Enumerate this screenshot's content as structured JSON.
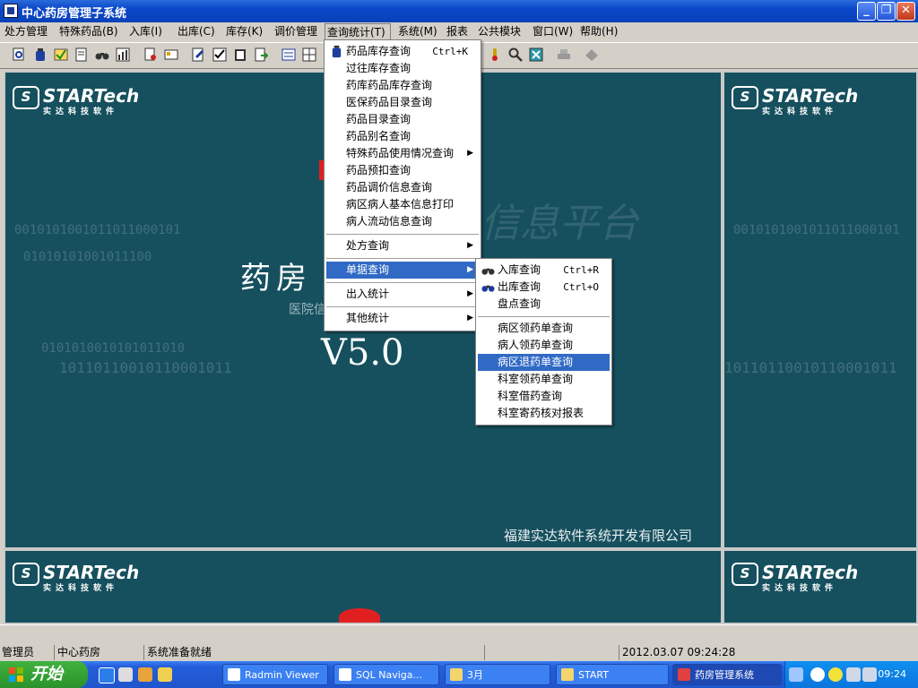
{
  "window": {
    "title": "中心药房管理子系统",
    "buttons": {
      "minimize": "_",
      "restore": "❐",
      "close": "✕"
    }
  },
  "menubar": [
    {
      "label": "处方管理"
    },
    {
      "label": "特殊药品(B)"
    },
    {
      "label": "入库(I)"
    },
    {
      "label": "出库(C)"
    },
    {
      "label": "库存(K)"
    },
    {
      "label": "调价管理"
    },
    {
      "label": "查询统计(T)",
      "open": true
    },
    {
      "label": "系统(M)"
    },
    {
      "label": "报表"
    },
    {
      "label": "公共模块"
    },
    {
      "label": "窗口(W)"
    },
    {
      "label": "帮助(H)"
    }
  ],
  "toolbar": {
    "icons": [
      "print-preview-icon",
      "bottle-icon",
      "check-icon",
      "document-icon",
      "binoculars-icon",
      "chart-icon",
      "doc-stamp-icon",
      "card-icon",
      "list-edit-icon",
      "checklist-icon",
      "clipboard-icon",
      "report-icon",
      "form-icon",
      "grid-icon",
      "thermometer-icon",
      "magnifier-icon",
      "calculator-icon",
      "printer-icon",
      "exit-icon"
    ]
  },
  "splash": {
    "brand": "STARTech",
    "brand_sub": "实达科技软件",
    "title": "药房",
    "subtitle": "医院信",
    "version": "V5.0",
    "company": "福建实达软件系统开发有限公司",
    "background_watermark": "信息平台",
    "binary_rows": [
      "0010101001011011000101",
      "01010101001011100",
      "0101010010101011010",
      "10110110010110001011"
    ]
  },
  "query_menu": {
    "items": [
      {
        "label": "药品库存查询",
        "shortcut": "Ctrl+K",
        "icon": "bottle-icon"
      },
      {
        "label": "过往库存查询"
      },
      {
        "label": "药库药品库存查询"
      },
      {
        "label": "医保药品目录查询"
      },
      {
        "label": "药品目录查询"
      },
      {
        "label": "药品别名查询"
      },
      {
        "label": "特殊药品使用情况查询",
        "submenu": true
      },
      {
        "label": "药品预扣查询"
      },
      {
        "label": "药品调价信息查询"
      },
      {
        "label": "病区病人基本信息打印"
      },
      {
        "label": "病人流动信息查询"
      }
    ],
    "group2": [
      {
        "label": "处方查询",
        "submenu": true
      },
      {
        "label": "单据查询",
        "submenu": true,
        "highlighted": true
      },
      {
        "label": "出入统计",
        "submenu": true
      },
      {
        "label": "其他统计",
        "submenu": true
      }
    ]
  },
  "doc_submenu": {
    "items": [
      {
        "label": "入库查询",
        "shortcut": "Ctrl+R",
        "icon": "binoculars-icon"
      },
      {
        "label": "出库查询",
        "shortcut": "Ctrl+O",
        "icon": "binoculars-icon"
      },
      {
        "label": "盘点查询"
      }
    ],
    "group2": [
      {
        "label": "病区领药单查询"
      },
      {
        "label": "病人领药单查询"
      },
      {
        "label": "病区退药单查询",
        "highlighted": true
      },
      {
        "label": "科室领药单查询"
      },
      {
        "label": "科室借药查询"
      },
      {
        "label": "科室寄药核对报表"
      }
    ]
  },
  "status": {
    "user": "管理员",
    "dept": "中心药房",
    "message": "系统准备就绪",
    "datetime": "2012.03.07 09:24:28"
  },
  "taskbar": {
    "start_label": "开始",
    "tasks": [
      {
        "label": "Radmin Viewer"
      },
      {
        "label": "SQL Naviga..."
      },
      {
        "label": "3月"
      },
      {
        "label": "START"
      },
      {
        "label": "药房管理系统",
        "active": true
      }
    ],
    "clock": "09:24"
  },
  "colors": {
    "panel_bg": "#16505e",
    "menu_highlight": "#316ac5",
    "titlebar": "#0a46c9"
  }
}
